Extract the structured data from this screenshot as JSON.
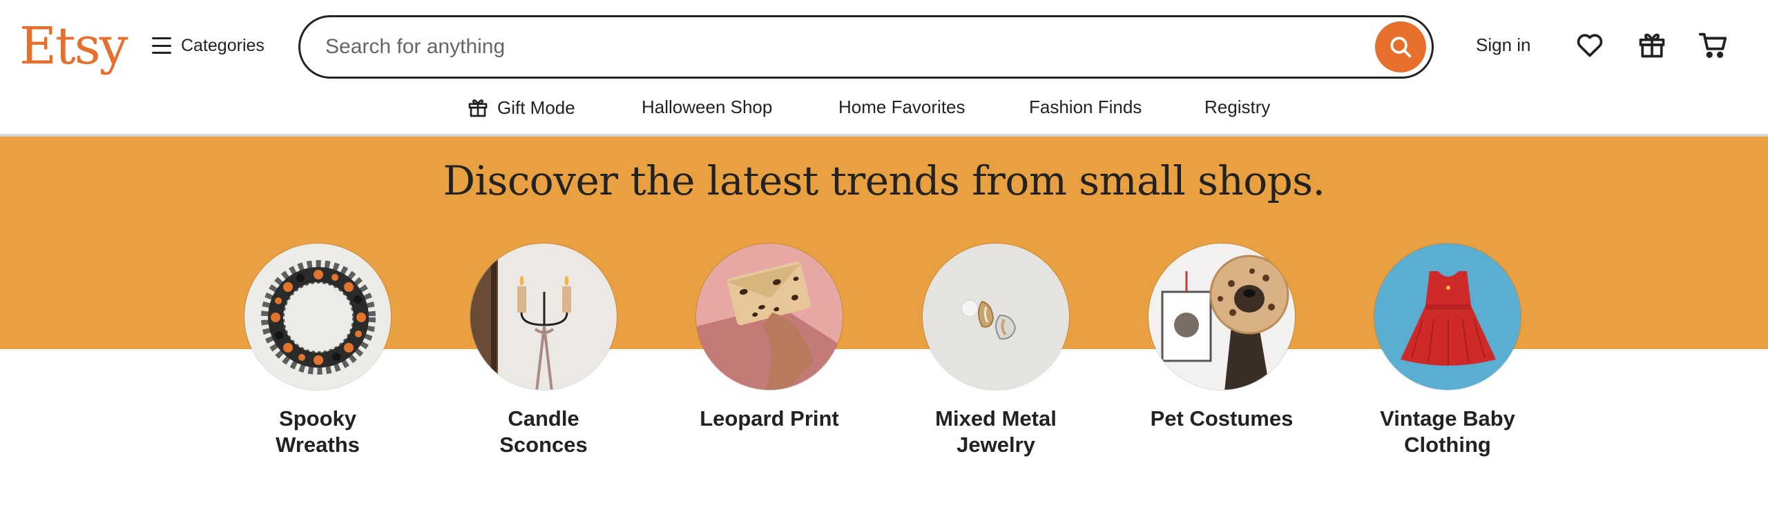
{
  "header": {
    "logo": "Etsy",
    "categories_label": "Categories",
    "search": {
      "placeholder": "Search for anything",
      "value": ""
    },
    "sign_in_label": "Sign in"
  },
  "subnav": {
    "items": [
      {
        "label": "Gift Mode",
        "icon": "gift-icon"
      },
      {
        "label": "Halloween Shop"
      },
      {
        "label": "Home Favorites"
      },
      {
        "label": "Fashion Finds"
      },
      {
        "label": "Registry"
      }
    ]
  },
  "banner": {
    "headline": "Discover the latest trends from small shops.",
    "background": "#e8a041"
  },
  "trend_categories": [
    {
      "label": "Spooky\nWreaths"
    },
    {
      "label": "Candle\nSconces"
    },
    {
      "label": "Leopard Print"
    },
    {
      "label": "Mixed Metal\nJewelry"
    },
    {
      "label": "Pet Costumes"
    },
    {
      "label": "Vintage Baby\nClothing"
    }
  ],
  "colors": {
    "brand": "#e66f2c",
    "text": "#222222",
    "banner": "#e8a041"
  }
}
